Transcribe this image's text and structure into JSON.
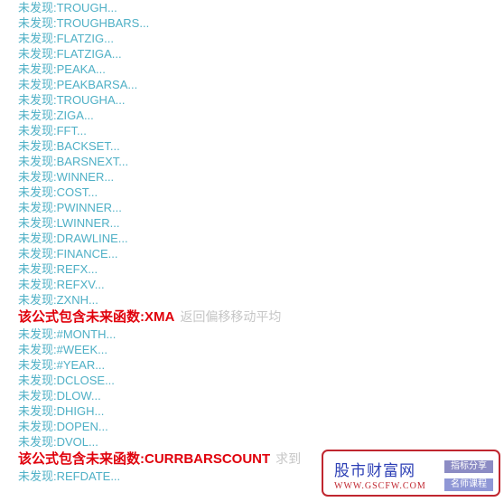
{
  "colors": {
    "missing_text": "#4fb0c6",
    "warning_text": "#e0000b",
    "warning_desc": "#c6c6c6",
    "watermark_border": "#c0262f",
    "watermark_title": "#2c3fb5"
  },
  "log": [
    {
      "type": "missing",
      "text": "未发现:TROUGH..."
    },
    {
      "type": "missing",
      "text": "未发现:TROUGHBARS..."
    },
    {
      "type": "missing",
      "text": "未发现:FLATZIG..."
    },
    {
      "type": "missing",
      "text": "未发现:FLATZIGA..."
    },
    {
      "type": "missing",
      "text": "未发现:PEAKA..."
    },
    {
      "type": "missing",
      "text": "未发现:PEAKBARSA..."
    },
    {
      "type": "missing",
      "text": "未发现:TROUGHA..."
    },
    {
      "type": "missing",
      "text": "未发现:ZIGA..."
    },
    {
      "type": "missing",
      "text": "未发现:FFT..."
    },
    {
      "type": "missing",
      "text": "未发现:BACKSET..."
    },
    {
      "type": "missing",
      "text": "未发现:BARSNEXT..."
    },
    {
      "type": "missing",
      "text": "未发现:WINNER..."
    },
    {
      "type": "missing",
      "text": "未发现:COST..."
    },
    {
      "type": "missing",
      "text": "未发现:PWINNER..."
    },
    {
      "type": "missing",
      "text": "未发现:LWINNER..."
    },
    {
      "type": "missing",
      "text": "未发现:DRAWLINE..."
    },
    {
      "type": "missing",
      "text": "未发现:FINANCE..."
    },
    {
      "type": "missing",
      "text": "未发现:REFX..."
    },
    {
      "type": "missing",
      "text": "未发现:REFXV..."
    },
    {
      "type": "missing",
      "text": "未发现:ZXNH..."
    },
    {
      "type": "warning",
      "text": "该公式包含未来函数:XMA",
      "desc": "返回偏移移动平均"
    },
    {
      "type": "missing",
      "text": "未发现:#MONTH..."
    },
    {
      "type": "missing",
      "text": "未发现:#WEEK..."
    },
    {
      "type": "missing",
      "text": "未发现:#YEAR..."
    },
    {
      "type": "missing",
      "text": "未发现:DCLOSE..."
    },
    {
      "type": "missing",
      "text": "未发现:DLOW..."
    },
    {
      "type": "missing",
      "text": "未发现:DHIGH..."
    },
    {
      "type": "missing",
      "text": "未发现:DOPEN..."
    },
    {
      "type": "missing",
      "text": "未发现:DVOL..."
    },
    {
      "type": "warning",
      "text": "该公式包含未来函数:CURRBARSCOUNT",
      "desc": "求到"
    },
    {
      "type": "missing",
      "text": "未发现:REFDATE..."
    }
  ],
  "watermark": {
    "title": "股市财富网",
    "url": "WWW.GSCFW.COM",
    "tag1": "指标分享",
    "tag2": "名师课程"
  }
}
